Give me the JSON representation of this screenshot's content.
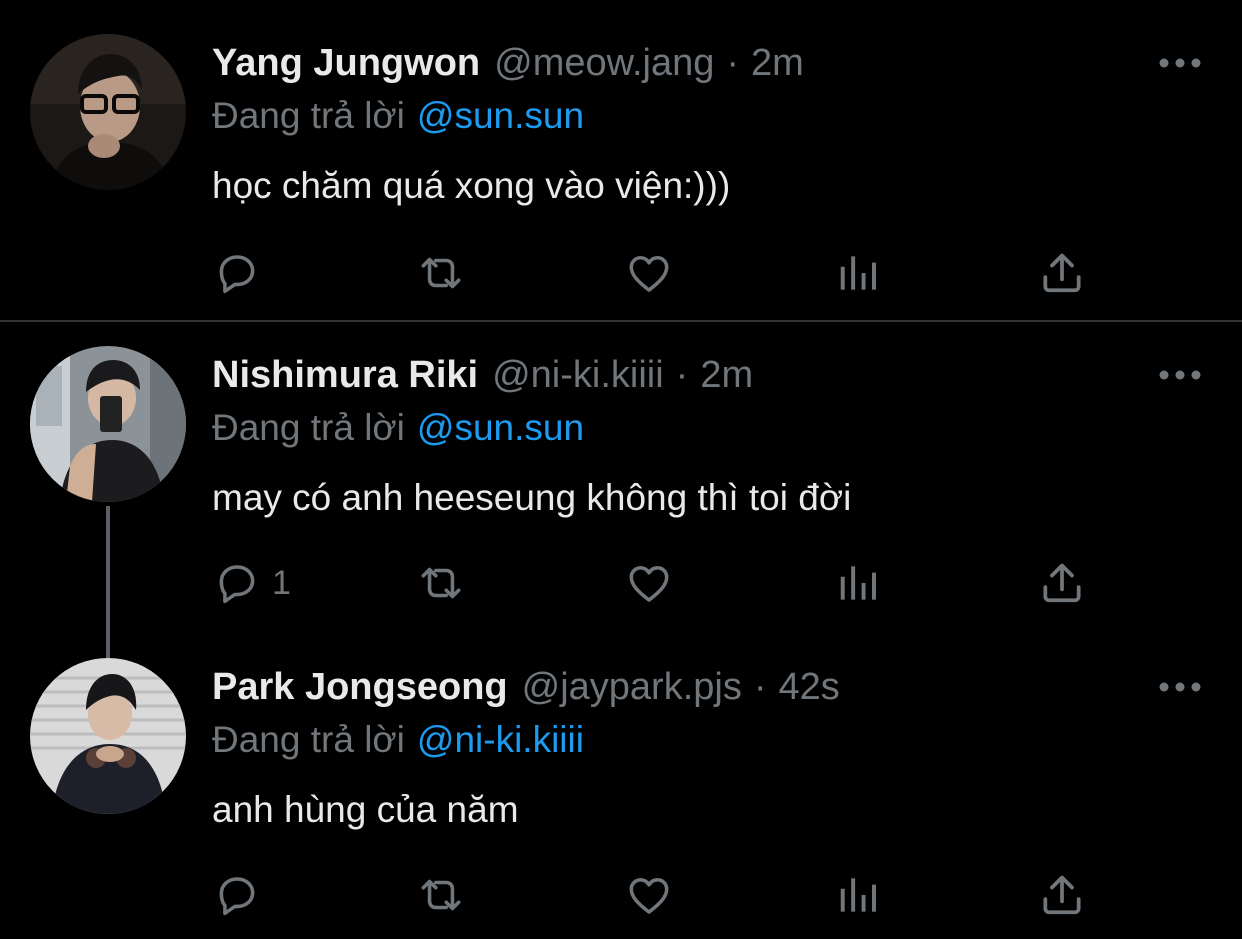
{
  "tweets": [
    {
      "display_name": "Yang Jungwon",
      "handle": "@meow.jang",
      "time": "2m",
      "replying_label": "Đang trả lời",
      "replying_to": "@sun.sun",
      "text": "học chăm quá xong vào viện:)))",
      "reply_count": ""
    },
    {
      "display_name": "Nishimura Riki",
      "handle": "@ni-ki.kiiii",
      "time": "2m",
      "replying_label": "Đang trả lời",
      "replying_to": "@sun.sun",
      "text": "may có anh heeseung không thì toi đời",
      "reply_count": "1"
    },
    {
      "display_name": "Park Jongseong",
      "handle": "@jaypark.pjs",
      "time": "42s",
      "replying_label": "Đang trả lời",
      "replying_to": "@ni-ki.kiiii",
      "text": "anh hùng của năm",
      "reply_count": ""
    }
  ],
  "separator": "·",
  "icons": [
    "more-icon",
    "reply-icon",
    "retweet-icon",
    "like-icon",
    "analytics-icon",
    "share-icon"
  ],
  "colors": {
    "background": "#000000",
    "text": "#e7e9ea",
    "muted": "#71767b",
    "link": "#1d9bf0",
    "divider": "#2f3336"
  }
}
